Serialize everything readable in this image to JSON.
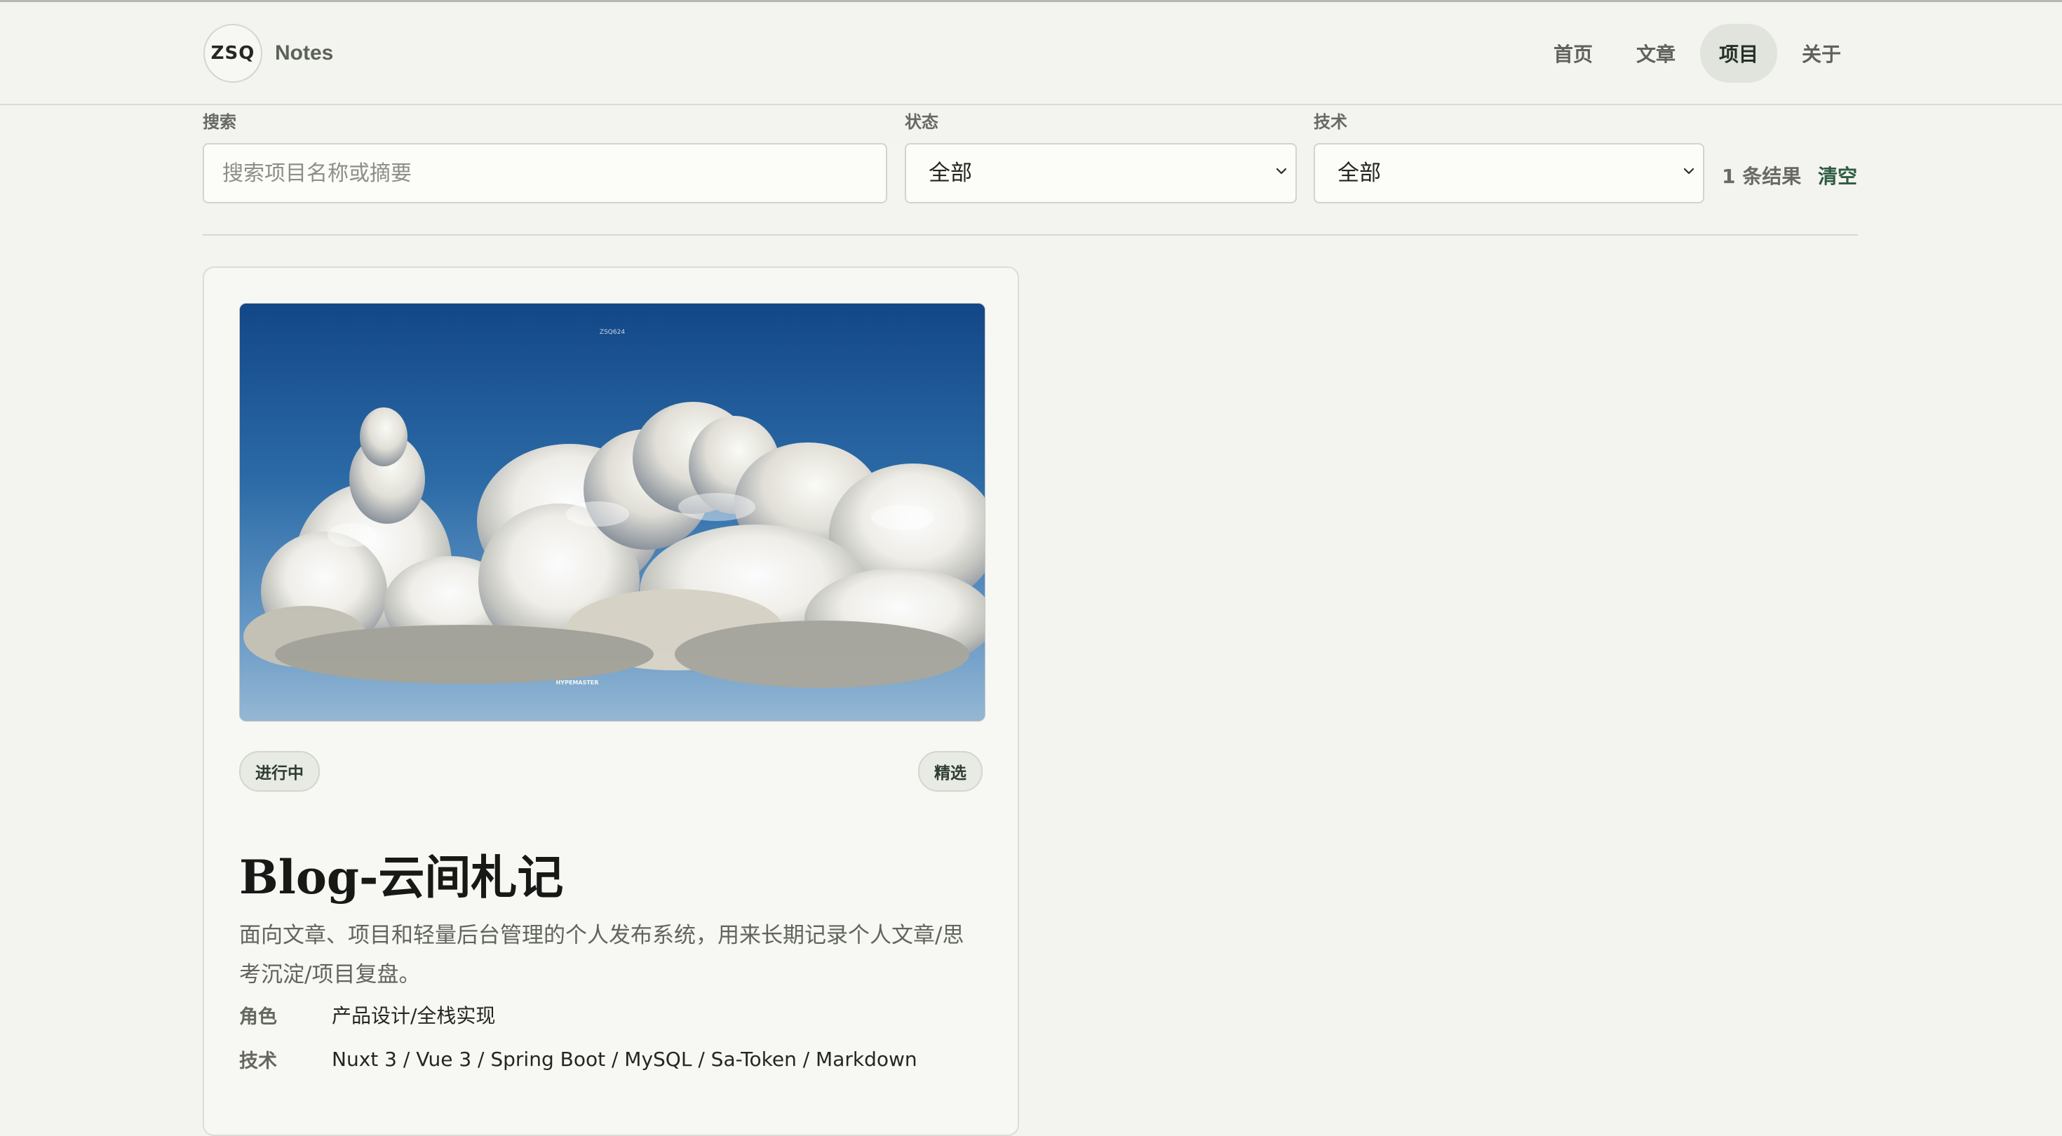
{
  "header": {
    "logo": "ZSQ",
    "site_name": "Notes",
    "nav": [
      {
        "label": "首页"
      },
      {
        "label": "文章"
      },
      {
        "label": "项目",
        "active": true
      },
      {
        "label": "关于"
      }
    ]
  },
  "filters": {
    "search_label": "搜索",
    "search_placeholder": "搜索项目名称或摘要",
    "search_value": "",
    "status_label": "状态",
    "status_value": "全部",
    "tech_label": "技术",
    "tech_value": "全部",
    "result_count": "1 条结果",
    "clear_label": "清空"
  },
  "projects": [
    {
      "status": "进行中",
      "featured": "精选",
      "title": "Blog-云间札记",
      "summary": "面向文章、项目和轻量后台管理的个人发布系统，用来长期记录个人文章/思考沉淀/项目复盘。",
      "meta": [
        {
          "label": "角色",
          "value": "产品设计/全栈实现"
        },
        {
          "label": "技术",
          "value": "Nuxt 3 / Vue 3 / Spring Boot / MySQL / Sa-Token / Markdown"
        }
      ],
      "image_text": {
        "top": "ZSQ624",
        "bottom": "HYPEMASTER"
      }
    }
  ],
  "colors": {
    "background": "#f3f3ef",
    "accent": "#2d5b3f",
    "border": "#d4d4cd"
  }
}
